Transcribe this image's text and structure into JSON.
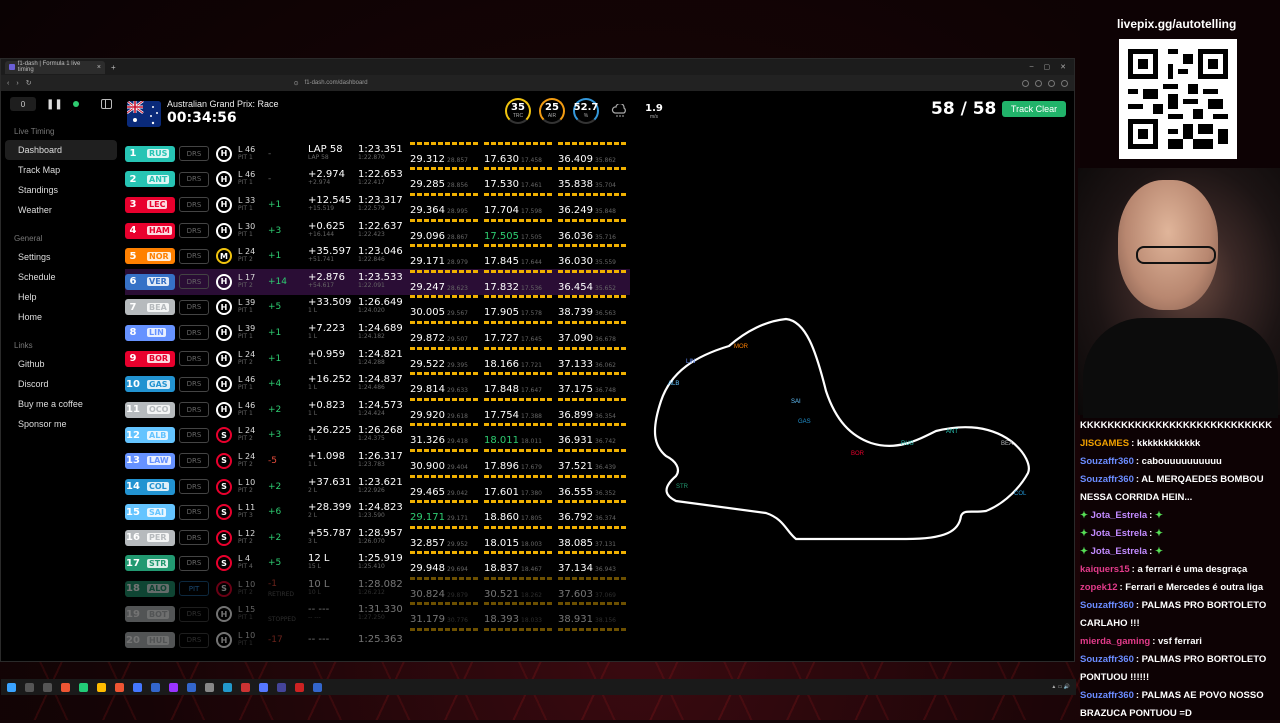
{
  "browser": {
    "tab_title": "f1-dash | Formula 1 live timing",
    "url": "f1-dash.com/dashboard"
  },
  "controls": {
    "lap_input": "0"
  },
  "sidebar": {
    "live_timing_title": "Live Timing",
    "live_items": [
      "Dashboard",
      "Track Map",
      "Standings",
      "Weather"
    ],
    "general_title": "General",
    "general_items": [
      "Settings",
      "Schedule",
      "Help",
      "Home"
    ],
    "links_title": "Links",
    "link_items": [
      "Github",
      "Discord",
      "Buy me a coffee",
      "Sponsor me"
    ]
  },
  "header": {
    "race_name": "Australian Grand Prix: Race",
    "session_clock": "00:34:56",
    "lap_count": "58 / 58",
    "track_status": "Track Clear"
  },
  "weather": [
    {
      "value": "35",
      "label": "TRC",
      "color": "#f1c40f"
    },
    {
      "value": "25",
      "label": "AIR",
      "color": "#f39c12"
    },
    {
      "value": "52.7",
      "label": "%",
      "color": "#3498db"
    }
  ],
  "wind": {
    "value": "1.9",
    "unit": "m/s"
  },
  "colors": {
    "track_clear": "#21b36a",
    "sector_bar": "#f0b000",
    "personal_best": "#2ecc71",
    "overall_best": "#a64dff"
  },
  "drivers": [
    {
      "pos": "1",
      "code": "RUS",
      "team_color": "#27c4b4",
      "drs": "DRS",
      "tyre": "H",
      "tyre_color": "#ffffff",
      "lap": "L 46",
      "pit": "PIT 1",
      "gain": "-",
      "gap": "LAP 58",
      "gap_sub": "LAP 58",
      "last": "1:23.351",
      "best": "1:22.870",
      "s1": "29.312",
      "s1b": "28.857",
      "s2": "17.630",
      "s2b": "17.458",
      "s3": "36.409",
      "s3b": "35.862"
    },
    {
      "pos": "2",
      "code": "ANT",
      "team_color": "#27c4b4",
      "drs": "DRS",
      "tyre": "H",
      "tyre_color": "#ffffff",
      "lap": "L 46",
      "pit": "PIT 1",
      "gain": "-",
      "gap": "+2.974",
      "gap_sub": "+2.974",
      "last": "1:22.653",
      "best": "1:22.417",
      "s1": "29.285",
      "s1b": "28.856",
      "s2": "17.530",
      "s2b": "17.461",
      "s3": "35.838",
      "s3b": "35.704"
    },
    {
      "pos": "3",
      "code": "LEC",
      "team_color": "#e8002d",
      "drs": "DRS",
      "tyre": "H",
      "tyre_color": "#ffffff",
      "lap": "L 33",
      "pit": "PIT 1",
      "gain": "+1",
      "gap": "+12.545",
      "gap_sub": "+15.519",
      "last": "1:23.317",
      "best": "1:22.579",
      "s1": "29.364",
      "s1b": "28.995",
      "s2": "17.704",
      "s2b": "17.598",
      "s3": "36.249",
      "s3b": "35.848"
    },
    {
      "pos": "4",
      "code": "HAM",
      "team_color": "#e8002d",
      "drs": "DRS",
      "tyre": "H",
      "tyre_color": "#ffffff",
      "lap": "L 30",
      "pit": "PIT 1",
      "gain": "+3",
      "gap": "+0.625",
      "gap_sub": "+16.144",
      "last": "1:22.637",
      "best": "1:22.423",
      "s1": "29.096",
      "s1b": "28.867",
      "s2": "17.505",
      "s2b": "17.505",
      "s3": "36.036",
      "s3b": "35.716"
    },
    {
      "pos": "5",
      "code": "NOR",
      "team_color": "#ff8000",
      "drs": "DRS",
      "tyre": "M",
      "tyre_color": "#f1c40f",
      "lap": "L 24",
      "pit": "PIT 2",
      "gain": "+1",
      "gap": "+35.597",
      "gap_sub": "+51.741",
      "last": "1:23.046",
      "best": "1:22.846",
      "s1": "29.171",
      "s1b": "28.979",
      "s2": "17.845",
      "s2b": "17.644",
      "s3": "36.030",
      "s3b": "35.559"
    },
    {
      "pos": "6",
      "code": "VER",
      "team_color": "#3671c6",
      "drs": "DRS",
      "tyre": "H",
      "tyre_color": "#ffffff",
      "lap": "L 17",
      "pit": "PIT 2",
      "gain": "+14",
      "gap": "+2.876",
      "gap_sub": "+54.617",
      "last": "1:23.533",
      "best": "1:22.091",
      "s1": "29.247",
      "s1b": "28.623",
      "s2": "17.832",
      "s2b": "17.536",
      "s3": "36.454",
      "s3b": "35.652"
    },
    {
      "pos": "7",
      "code": "BEA",
      "team_color": "#b6babd",
      "drs": "DRS",
      "tyre": "H",
      "tyre_color": "#ffffff",
      "lap": "L 39",
      "pit": "PIT 1",
      "gain": "+5",
      "gap": "+33.509",
      "gap_sub": "1 L",
      "last": "1:26.649",
      "best": "1:24.020",
      "s1": "30.005",
      "s1b": "29.567",
      "s2": "17.905",
      "s2b": "17.578",
      "s3": "38.739",
      "s3b": "36.563"
    },
    {
      "pos": "8",
      "code": "LIN",
      "team_color": "#6692ff",
      "drs": "DRS",
      "tyre": "H",
      "tyre_color": "#ffffff",
      "lap": "L 39",
      "pit": "PIT 1",
      "gain": "+1",
      "gap": "+7.223",
      "gap_sub": "1 L",
      "last": "1:24.689",
      "best": "1:24.182",
      "s1": "29.872",
      "s1b": "29.507",
      "s2": "17.727",
      "s2b": "17.645",
      "s3": "37.090",
      "s3b": "36.678"
    },
    {
      "pos": "9",
      "code": "BOR",
      "team_color": "#e8002d",
      "drs": "DRS",
      "tyre": "H",
      "tyre_color": "#ffffff",
      "lap": "L 24",
      "pit": "PIT 2",
      "gain": "+1",
      "gap": "+0.959",
      "gap_sub": "1 L",
      "last": "1:24.821",
      "best": "1:24.288",
      "s1": "29.522",
      "s1b": "29.395",
      "s2": "18.166",
      "s2b": "17.721",
      "s3": "37.133",
      "s3b": "36.062"
    },
    {
      "pos": "10",
      "code": "GAS",
      "team_color": "#2293d1",
      "drs": "DRS",
      "tyre": "H",
      "tyre_color": "#ffffff",
      "lap": "L 46",
      "pit": "PIT 1",
      "gain": "+4",
      "gap": "+16.252",
      "gap_sub": "1 L",
      "last": "1:24.837",
      "best": "1:24.486",
      "s1": "29.814",
      "s1b": "29.633",
      "s2": "17.848",
      "s2b": "17.647",
      "s3": "37.175",
      "s3b": "36.748"
    },
    {
      "pos": "11",
      "code": "OCO",
      "team_color": "#b6babd",
      "drs": "DRS",
      "tyre": "H",
      "tyre_color": "#ffffff",
      "lap": "L 46",
      "pit": "PIT 1",
      "gain": "+2",
      "gap": "+0.823",
      "gap_sub": "1 L",
      "last": "1:24.573",
      "best": "1:24.424",
      "s1": "29.920",
      "s1b": "29.618",
      "s2": "17.754",
      "s2b": "17.388",
      "s3": "36.899",
      "s3b": "36.354"
    },
    {
      "pos": "12",
      "code": "ALB",
      "team_color": "#64c4ff",
      "drs": "DRS",
      "tyre": "S",
      "tyre_color": "#e8002d",
      "lap": "L 24",
      "pit": "PIT 2",
      "gain": "+3",
      "gap": "+26.225",
      "gap_sub": "1 L",
      "last": "1:26.268",
      "best": "1:24.375",
      "s1": "31.326",
      "s1b": "29.418",
      "s2": "18.011",
      "s2b": "18.011",
      "s3": "36.931",
      "s3b": "36.742"
    },
    {
      "pos": "13",
      "code": "LAW",
      "team_color": "#6692ff",
      "drs": "DRS",
      "tyre": "S",
      "tyre_color": "#e8002d",
      "lap": "L 24",
      "pit": "PIT 2",
      "gain": "-5",
      "gap": "+1.098",
      "gap_sub": "1 L",
      "last": "1:26.317",
      "best": "1:23.783",
      "s1": "30.900",
      "s1b": "29.404",
      "s2": "17.896",
      "s2b": "17.679",
      "s3": "37.521",
      "s3b": "36.439"
    },
    {
      "pos": "14",
      "code": "COL",
      "team_color": "#2293d1",
      "drs": "DRS",
      "tyre": "S",
      "tyre_color": "#e8002d",
      "lap": "L 10",
      "pit": "PIT 2",
      "gain": "+2",
      "gap": "+37.631",
      "gap_sub": "2 L",
      "last": "1:23.621",
      "best": "1:22.926",
      "s1": "29.465",
      "s1b": "29.042",
      "s2": "17.601",
      "s2b": "17.380",
      "s3": "36.555",
      "s3b": "36.352"
    },
    {
      "pos": "15",
      "code": "SAI",
      "team_color": "#64c4ff",
      "drs": "DRS",
      "tyre": "S",
      "tyre_color": "#e8002d",
      "lap": "L 11",
      "pit": "PIT 3",
      "gain": "+6",
      "gap": "+28.399",
      "gap_sub": "2 L",
      "last": "1:24.823",
      "best": "1:23.590",
      "s1": "29.171",
      "s1b": "29.171",
      "s2": "18.860",
      "s2b": "17.805",
      "s3": "36.792",
      "s3b": "36.374"
    },
    {
      "pos": "16",
      "code": "PER",
      "team_color": "#b6babd",
      "drs": "DRS",
      "tyre": "S",
      "tyre_color": "#e8002d",
      "lap": "L 12",
      "pit": "PIT 2",
      "gain": "+2",
      "gap": "+55.787",
      "gap_sub": "3 L",
      "last": "1:28.957",
      "best": "1:26.070",
      "s1": "32.857",
      "s1b": "29.952",
      "s2": "18.015",
      "s2b": "18.003",
      "s3": "38.085",
      "s3b": "37.131"
    },
    {
      "pos": "17",
      "code": "STR",
      "team_color": "#229971",
      "drs": "DRS",
      "tyre": "S",
      "tyre_color": "#e8002d",
      "lap": "L 4",
      "pit": "PIT 4",
      "gain": "+5",
      "gap": "12 L",
      "gap_sub": "15 L",
      "last": "1:25.919",
      "best": "1:25.410",
      "s1": "29.948",
      "s1b": "29.694",
      "s2": "18.837",
      "s2b": "18.467",
      "s3": "37.134",
      "s3b": "36.943"
    },
    {
      "pos": "18",
      "code": "ALO",
      "team_color": "#229971",
      "drs": "PIT",
      "tyre": "S",
      "tyre_color": "#e8002d",
      "lap": "L 10",
      "pit": "PIT 2",
      "gain": "-1",
      "gap": "10 L",
      "gap_sub": "10 L",
      "last": "1:28.082",
      "best": "1:26.212",
      "s1": "30.824",
      "s1b": "29.879",
      "s2": "30.521",
      "s2b": "18.262",
      "s3": "37.603",
      "s3b": "37.069",
      "status": "RETIRED"
    },
    {
      "pos": "19",
      "code": "BOT",
      "team_color": "#b6babd",
      "drs": "DRS",
      "tyre": "H",
      "tyre_color": "#ffffff",
      "lap": "L 15",
      "pit": "PIT 1",
      "gain": "",
      "gap": "-- ---",
      "gap_sub": "-- ---",
      "last": "1:31.330",
      "best": "1:27.250",
      "s1": "31.179",
      "s1b": "30.776",
      "s2": "18.393",
      "s2b": "18.033",
      "s3": "38.931",
      "s3b": "38.156",
      "status": "STOPPED"
    },
    {
      "pos": "20",
      "code": "HUL",
      "team_color": "#b6babd",
      "drs": "DRS",
      "tyre": "H",
      "tyre_color": "#ffffff",
      "lap": "L 10",
      "pit": "PIT 1",
      "gain": "-17",
      "gap": "-- ---",
      "gap_sub": "",
      "last": "1:25.363",
      "best": "",
      "s1": "",
      "s1b": "",
      "s2": "",
      "s2b": "",
      "s3": "",
      "s3b": ""
    }
  ],
  "track_labels": [
    {
      "code": "MOR",
      "color": "#ff8000"
    },
    {
      "code": "LIN",
      "color": "#6692ff"
    },
    {
      "code": "ALB",
      "color": "#64c4ff"
    },
    {
      "code": "SAI",
      "color": "#64c4ff"
    },
    {
      "code": "GAS",
      "color": "#2293d1"
    },
    {
      "code": "BOR",
      "color": "#e8002d"
    },
    {
      "code": "RUS",
      "color": "#27c4b4"
    },
    {
      "code": "ANT",
      "color": "#27c4b4"
    },
    {
      "code": "BEA",
      "color": "#b6babd"
    },
    {
      "code": "COL",
      "color": "#2293d1"
    },
    {
      "code": "STR",
      "color": "#229971"
    }
  ],
  "stream": {
    "livepix": "livepix.gg/autotelling"
  },
  "chat": [
    {
      "user": "",
      "user_color": "#ffffff",
      "text": "KKKKKKKKKKKKKKKKKKKKKKKKKKKK"
    },
    {
      "user": "JISGAMES",
      "user_color": "#f0a000",
      "text": ": kkkkkkkkkkkk"
    },
    {
      "user": "Souzaffr360",
      "user_color": "#6b8cff",
      "text": ": cabouuuuuuuuuu"
    },
    {
      "user": "Souzaffr360",
      "user_color": "#6b8cff",
      "text": ": AL MERQAEDES BOMBOU NESSA CORRIDA HEIN..."
    },
    {
      "user": "Jota_Estrela",
      "user_color": "#c28bff",
      "text": ":"
    },
    {
      "user": "Jota_Estrela",
      "user_color": "#c28bff",
      "text": ":"
    },
    {
      "user": "Jota_Estrela",
      "user_color": "#c28bff",
      "text": ":"
    },
    {
      "user": "kaiquers15",
      "user_color": "#e23b8a",
      "text": ": a ferrari é uma desgraça"
    },
    {
      "user": "zopek12",
      "user_color": "#e23b8a",
      "text": ": Ferrari e Mercedes é outra liga"
    },
    {
      "user": "Souzaffr360",
      "user_color": "#6b8cff",
      "text": ": PALMAS PRO BORTOLETO CARLAHO !!!"
    },
    {
      "user": "mierda_gaming",
      "user_color": "#e23b8a",
      "text": ": vsf ferrari"
    },
    {
      "user": "Souzaffr360",
      "user_color": "#6b8cff",
      "text": ": PALMAS PRO BORTOLETO PONTUOU !!!!!!"
    },
    {
      "user": "Souzaffr360",
      "user_color": "#6b8cff",
      "text": ": PALMAS AE POVO NOSSO BRAZUCA PONTUOU =D"
    }
  ]
}
